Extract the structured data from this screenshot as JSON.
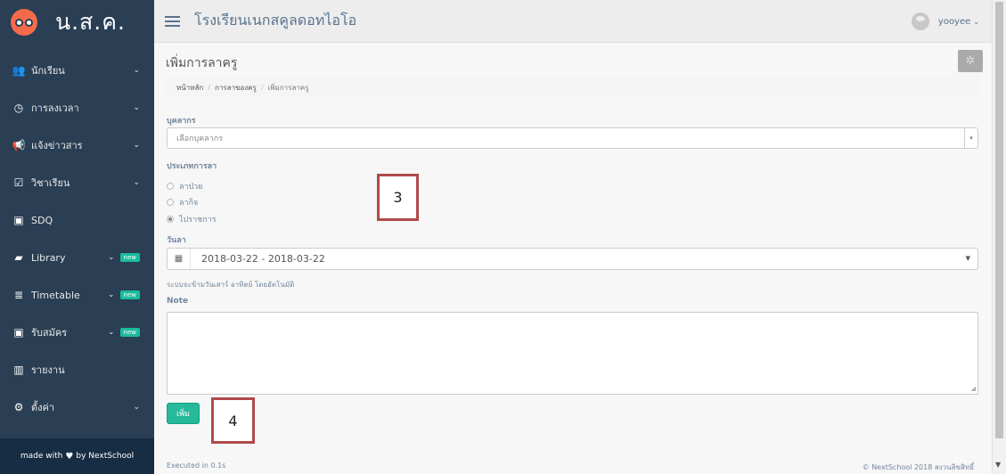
{
  "brand": {
    "title": "น.ส.ค."
  },
  "sidebar": {
    "items": [
      {
        "label": "นักเรียน",
        "icon": "users-icon",
        "glyph": "👥",
        "chevron": "⌄"
      },
      {
        "label": "การลงเวลา",
        "icon": "clock-icon",
        "glyph": "◷",
        "chevron": "⌄"
      },
      {
        "label": "แจ้งข่าวสาร",
        "icon": "megaphone-icon",
        "glyph": "📢",
        "chevron": "⌄"
      },
      {
        "label": "วิชาเรียน",
        "icon": "calendar-check-icon",
        "glyph": "☑",
        "chevron": "⌄"
      },
      {
        "label": "SDQ",
        "icon": "id-card-icon",
        "glyph": "▣",
        "chevron": ""
      },
      {
        "label": "Library",
        "icon": "book-icon",
        "glyph": "▰",
        "chevron": "⌄",
        "badge": "new"
      },
      {
        "label": "Timetable",
        "icon": "server-icon",
        "glyph": "≣",
        "chevron": "⌄",
        "badge": "new"
      },
      {
        "label": "รับสมัคร",
        "icon": "form-icon",
        "glyph": "▣",
        "chevron": "⌄",
        "badge": "new"
      },
      {
        "label": "รายงาน",
        "icon": "bar-chart-icon",
        "glyph": "▥",
        "chevron": ""
      },
      {
        "label": "ตั้งค่า",
        "icon": "gears-icon",
        "glyph": "⚙",
        "chevron": "⌄"
      }
    ],
    "footer": {
      "prefix": "made with",
      "suffix": "by NextSchool"
    }
  },
  "topbar": {
    "school_name": "โรงเรียนเนกสคูลดอทไอโอ",
    "username": "yooyee"
  },
  "page": {
    "title": "เพิ่มการลาครู",
    "breadcrumb": [
      "หน้าหลัก",
      "การลาของครู",
      "เพิ่มการลาครู"
    ]
  },
  "form": {
    "person_label": "บุคลากร",
    "person_placeholder": "เลือกบุคลากร",
    "leave_type_label": "ประเภทการลา",
    "leave_types": [
      {
        "label": "ลาป่วย",
        "checked": false
      },
      {
        "label": "ลากิจ",
        "checked": false
      },
      {
        "label": "ไปราชการ",
        "checked": true
      }
    ],
    "date_label": "วันลา",
    "date_range": "2018-03-22 - 2018-03-22",
    "weekend_hint": "ระบบจะข้ามวันเสาร์ อาทิตย์ โดยอัตโนมัติ",
    "note_label": "Note",
    "note_value": "",
    "submit_label": "เพิ่ม"
  },
  "footer": {
    "left": "Executed in 0.1s",
    "right": "© NextSchool 2018 สงวนลิขสิทธิ์"
  },
  "annotations": [
    "3",
    "4"
  ]
}
